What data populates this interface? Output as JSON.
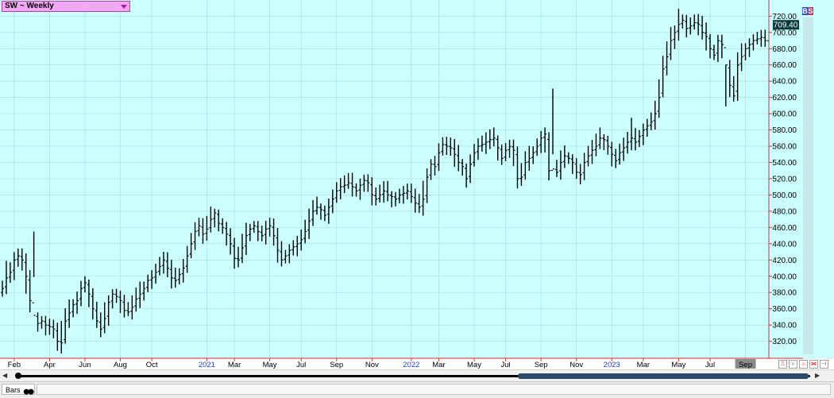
{
  "header": {
    "symbol_label": "SW ~ Weekly"
  },
  "price_badge": "709.40",
  "bs_buttons": {
    "b": "B",
    "s": "S"
  },
  "bottom": {
    "tab_label": "Bars"
  },
  "colors": {
    "plot_bg": "#ccffff",
    "grid": "#a8dada",
    "bar": "#000000",
    "axis_line": "#e03030",
    "badge_bg": "#0b3a3a"
  },
  "chart_data": {
    "type": "ohlc",
    "ylim": [
      303,
      735
    ],
    "y_ticks": [
      320,
      340,
      360,
      380,
      400,
      420,
      440,
      460,
      480,
      500,
      520,
      540,
      560,
      580,
      600,
      620,
      640,
      660,
      680,
      700,
      720
    ],
    "x_labels": [
      {
        "label": "Feb",
        "week": 3,
        "year": false
      },
      {
        "label": "Apr",
        "week": 12,
        "year": false
      },
      {
        "label": "Jun",
        "week": 21,
        "year": false
      },
      {
        "label": "Aug",
        "week": 30,
        "year": false
      },
      {
        "label": "Oct",
        "week": 38,
        "year": false
      },
      {
        "label": "2021",
        "week": 52,
        "year": true
      },
      {
        "label": "Mar",
        "week": 59,
        "year": false
      },
      {
        "label": "May",
        "week": 68,
        "year": false
      },
      {
        "label": "Jul",
        "week": 76,
        "year": false
      },
      {
        "label": "Sep",
        "week": 85,
        "year": false
      },
      {
        "label": "Nov",
        "week": 94,
        "year": false
      },
      {
        "label": "2022",
        "week": 104,
        "year": true
      },
      {
        "label": "Mar",
        "week": 111,
        "year": false
      },
      {
        "label": "May",
        "week": 120,
        "year": false
      },
      {
        "label": "Jul",
        "week": 128,
        "year": false
      },
      {
        "label": "Sep",
        "week": 137,
        "year": false
      },
      {
        "label": "Nov",
        "week": 146,
        "year": false
      },
      {
        "label": "2023",
        "week": 155,
        "year": true
      },
      {
        "label": "Mar",
        "week": 163,
        "year": false
      },
      {
        "label": "May",
        "week": 172,
        "year": false
      },
      {
        "label": "Jul",
        "week": 180,
        "year": false
      },
      {
        "label": "Sep",
        "week": 189,
        "year": false
      }
    ],
    "closes": [
      385,
      398,
      405,
      420,
      425,
      420,
      400,
      370,
      352,
      342,
      345,
      340,
      338,
      335,
      320,
      318,
      345,
      355,
      365,
      370,
      385,
      392,
      378,
      360,
      345,
      335,
      348,
      368,
      378,
      375,
      370,
      358,
      356,
      362,
      372,
      378,
      385,
      395,
      398,
      405,
      412,
      420,
      410,
      398,
      395,
      402,
      410,
      425,
      440,
      455,
      462,
      452,
      458,
      470,
      478,
      465,
      460,
      452,
      440,
      422,
      420,
      435,
      450,
      458,
      462,
      455,
      450,
      458,
      462,
      450,
      432,
      420,
      425,
      432,
      436,
      440,
      445,
      455,
      468,
      480,
      485,
      482,
      475,
      485,
      495,
      505,
      510,
      512,
      515,
      510,
      505,
      512,
      518,
      515,
      500,
      495,
      500,
      505,
      500,
      498,
      495,
      500,
      502,
      505,
      498,
      490,
      485,
      495,
      522,
      538,
      535,
      552,
      562,
      560,
      558,
      550,
      540,
      535,
      520,
      538,
      552,
      560,
      562,
      565,
      568,
      570,
      558,
      545,
      555,
      560,
      555,
      520,
      522,
      540,
      545,
      552,
      560,
      570,
      575,
      530,
      532,
      528,
      540,
      548,
      545,
      540,
      528,
      525,
      540,
      548,
      555,
      560,
      570,
      568,
      560,
      550,
      542,
      552,
      558,
      565,
      570,
      565,
      572,
      580,
      585,
      590,
      600,
      620,
      655,
      670,
      690,
      700,
      710,
      715,
      705,
      708,
      712,
      710,
      700,
      695,
      680,
      672,
      690,
      685,
      660,
      635,
      622,
      660,
      670,
      680,
      685,
      690,
      692,
      694,
      690,
      688,
      700,
      709.4
    ],
    "ranges": [
      {
        "week": 1,
        "high": 419,
        "low": 378
      },
      {
        "week": 8,
        "high": 455,
        "low": 399
      },
      {
        "week": 15,
        "high": 345,
        "low": 305
      },
      {
        "week": 22,
        "high": 396,
        "low": 362
      },
      {
        "week": 140,
        "high": 631,
        "low": 550
      },
      {
        "week": 160,
        "high": 595,
        "low": 555
      },
      {
        "week": 172,
        "high": 729,
        "low": 690
      },
      {
        "week": 184,
        "high": 660,
        "low": 609
      }
    ]
  }
}
